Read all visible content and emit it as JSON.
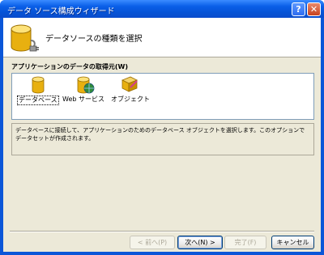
{
  "window": {
    "title": "データ ソース構成ウィザード",
    "help_icon": "help-icon",
    "close_icon": "close-icon"
  },
  "header": {
    "icon": "database-plug-icon",
    "title": "データソースの種類を選択"
  },
  "source_section": {
    "label": "アプリケーションのデータの取得元(W)",
    "options": [
      {
        "label": "データベース",
        "icon": "database-icon",
        "selected": true
      },
      {
        "label": "Web サービス",
        "icon": "web-service-icon",
        "selected": false
      },
      {
        "label": "オブジェクト",
        "icon": "object-icon",
        "selected": false
      }
    ]
  },
  "description": "データベースに接続して、アプリケーションのためのデータベース オブジェクトを選択します。このオプションでデータセットが作成されます。",
  "buttons": {
    "back": "< 前へ(P)",
    "next": "次へ(N) >",
    "finish": "完了(F)",
    "cancel": "キャンセル"
  },
  "colors": {
    "titlebar": "#0a5fe8",
    "dialog_bg": "#ece9d8",
    "border": "#7f9db9"
  }
}
